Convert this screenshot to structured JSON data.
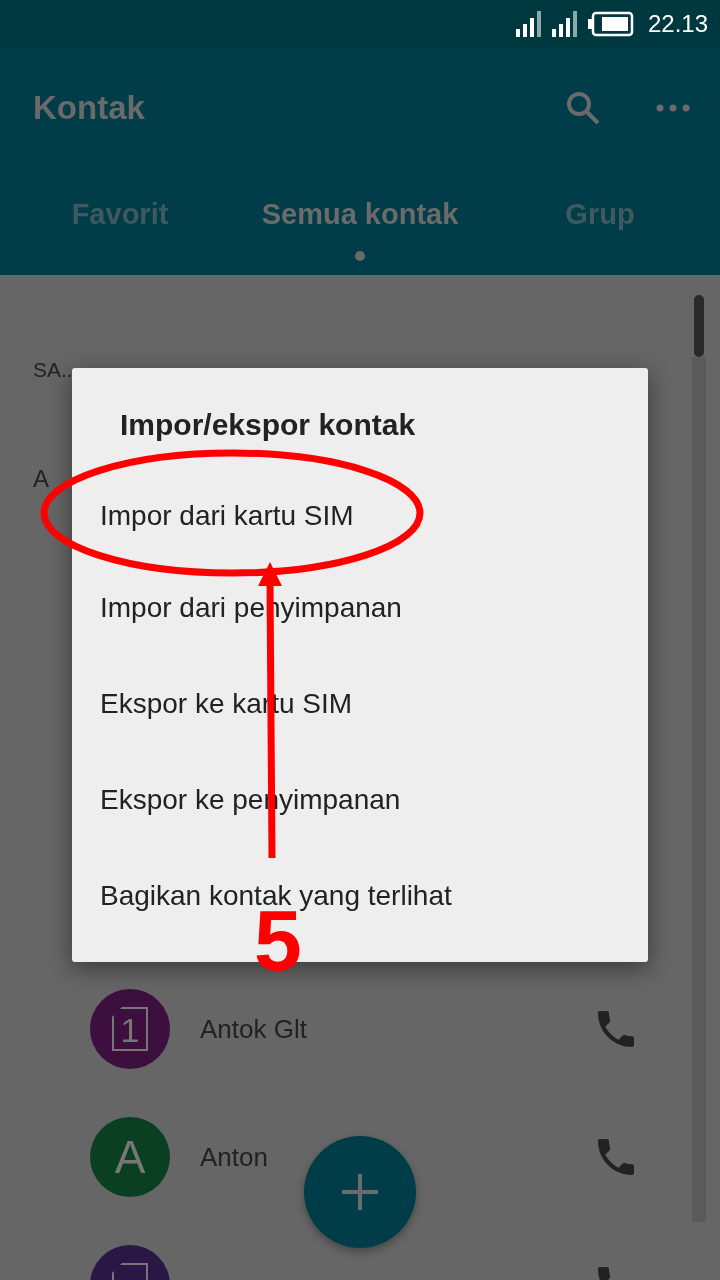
{
  "status_bar": {
    "time": "22.13"
  },
  "app_bar": {
    "title": "Kontak"
  },
  "tabs": [
    {
      "label": "Favorit",
      "selected": false
    },
    {
      "label": "Semua kontak",
      "selected": true
    },
    {
      "label": "Grup",
      "selected": false
    }
  ],
  "profile_row": {
    "label": "SA.."
  },
  "section_header": "A",
  "contacts": [
    {
      "name": "Antok Glt",
      "kind": "sim",
      "avatar_text": "1",
      "color": "#3c0f3f"
    },
    {
      "name": "Anton",
      "kind": "letter",
      "avatar_text": "A",
      "color": "#0a3f22"
    },
    {
      "kind": "sim",
      "color": "#2a1745"
    }
  ],
  "dialog": {
    "title": "Impor/ekspor kontak",
    "items": [
      "Impor dari kartu SIM",
      "Impor dari penyimpanan",
      "Ekspor ke kartu SIM",
      "Ekspor ke penyimpanan",
      "Bagikan kontak yang terlihat"
    ]
  },
  "annotation": {
    "step": "5"
  }
}
